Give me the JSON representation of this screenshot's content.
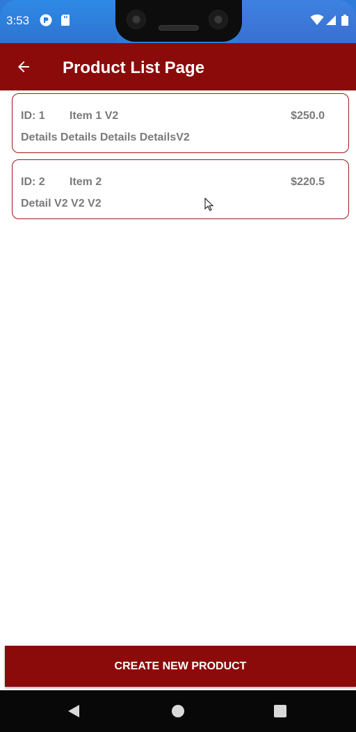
{
  "status_bar": {
    "time": "3:53",
    "icons": [
      "notification-icon",
      "sd-card-icon",
      "wifi-icon",
      "signal-icon",
      "battery-icon"
    ]
  },
  "app_bar": {
    "title": "Product List Page",
    "back_icon": "arrow-back-icon"
  },
  "products": [
    {
      "id_label": "ID: 1",
      "name": "Item 1 V2",
      "price": "$250.0",
      "details": "Details Details Details DetailsV2"
    },
    {
      "id_label": "ID: 2",
      "name": "Item 2",
      "price": "$220.5",
      "details": "Detail V2 V2 V2"
    }
  ],
  "actions": {
    "create_label": "CREATE NEW PRODUCT"
  },
  "nav_bar": {
    "icons": [
      "back-triangle-icon",
      "home-circle-icon",
      "recents-square-icon"
    ]
  },
  "colors": {
    "primary": "#8b0a0a",
    "status_bar": "#2f7bd9",
    "card_border": "#9c1a1a",
    "card_text": "#7a7a7a"
  }
}
